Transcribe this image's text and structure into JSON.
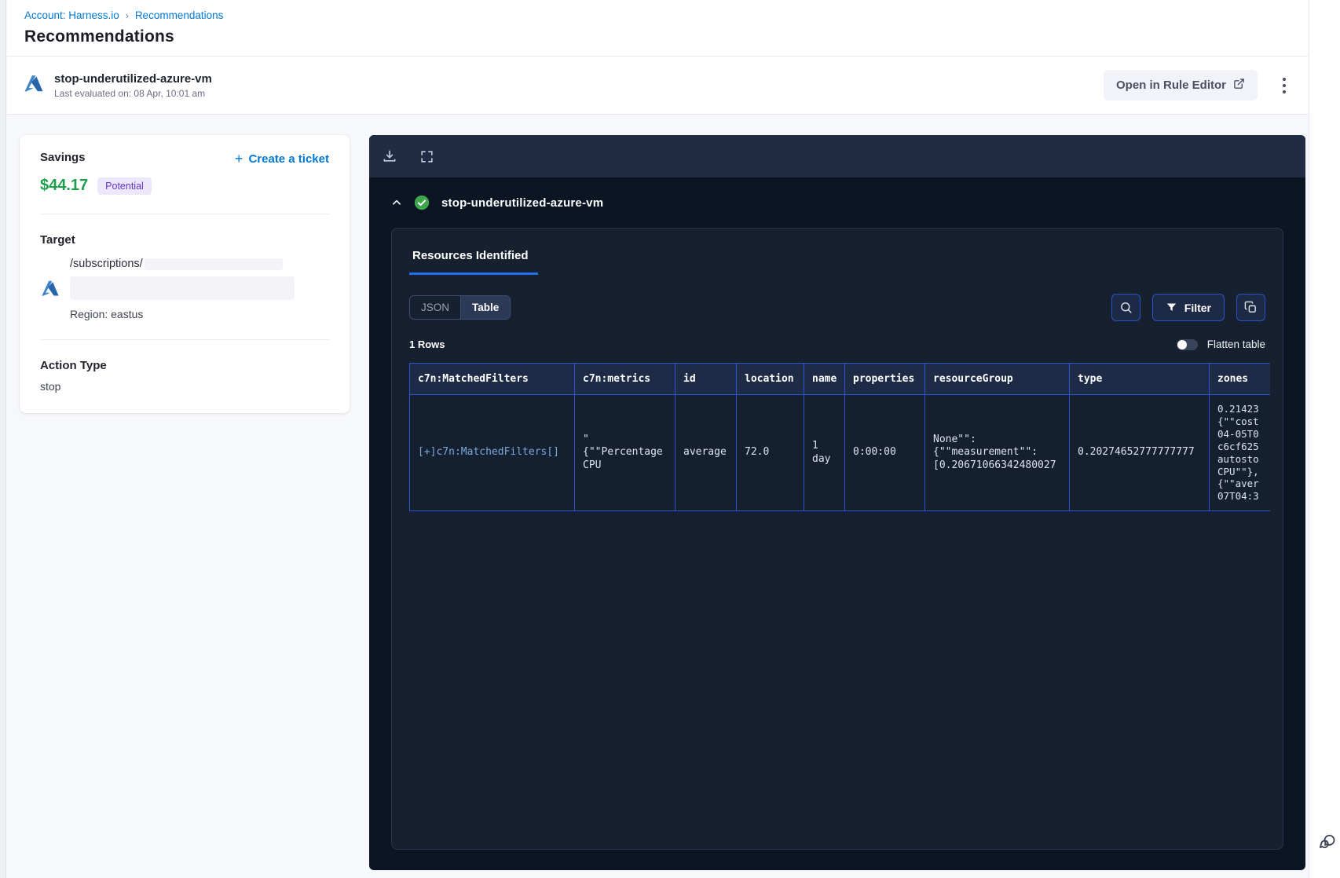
{
  "breadcrumb": {
    "account": "Account: Harness.io",
    "separator": "›",
    "current": "Recommendations"
  },
  "page": {
    "title": "Recommendations"
  },
  "header": {
    "name": "stop-underutilized-azure-vm",
    "last_evaluated": "Last evaluated on: 08 Apr, 10:01 am",
    "open_rule_editor_label": "Open in Rule Editor"
  },
  "details_card": {
    "savings_label": "Savings",
    "create_ticket_plus": "+",
    "create_ticket_label": "Create a ticket",
    "savings_amount": "$44.17",
    "savings_badge": "Potential",
    "target_label": "Target",
    "target_path": "/subscriptions/",
    "region": "Region: eastus",
    "action_type_label": "Action Type",
    "action_type_value": "stop"
  },
  "panel": {
    "title": "stop-underutilized-azure-vm",
    "tab_label": "Resources Identified",
    "view_toggle": {
      "json_label": "JSON",
      "table_label": "Table",
      "active": "Table"
    },
    "filter_label": "Filter",
    "rows_count": "1 Rows",
    "flatten_label": "Flatten table",
    "table": {
      "columns": [
        "c7n:MatchedFilters",
        "c7n:metrics",
        "id",
        "location",
        "name",
        "properties",
        "resourceGroup",
        "type",
        "zones"
      ],
      "row": {
        "matched_filters": "[+]c7n:MatchedFilters[]",
        "metrics_lines": [
          "\"",
          "{\"\"Percentage",
          "CPU"
        ],
        "id": "average",
        "location": "72.0",
        "name_lines": [
          "1",
          "day"
        ],
        "properties": "0:00:00",
        "resource_group_lines": [
          "None\"\":",
          "{\"\"measurement\"\":",
          "[0.20671066342480027"
        ],
        "type": "0.20274652777777777",
        "zones_lines": [
          "0.21423",
          "{\"\"cost",
          "04-05T0",
          "c6cf625",
          "autosto",
          "CPU\"\"},",
          "{\"\"aver",
          "07T04:3"
        ]
      }
    }
  },
  "icons": {
    "azure": "azure-logo-icon",
    "download": "download-icon",
    "fullscreen": "fullscreen-icon",
    "chevron_up": "chevron-up-icon",
    "check": "check-circle-icon",
    "search": "search-icon",
    "filter": "filter-icon",
    "copy": "copy-icon",
    "kebab": "kebab-menu-icon",
    "external_link": "external-link-icon",
    "chat": "chat-bubble-icon"
  },
  "colors": {
    "link_blue": "#0278d5",
    "savings_green": "#1f9e4d",
    "badge_bg": "#ece7fb",
    "badge_text": "#6236c9",
    "panel_bg": "#0b1524",
    "toolbar_bg": "#202c44",
    "inner_card_bg": "#16202f",
    "table_border_blue": "#2e54cf",
    "tab_underline_blue": "#1f6ff0",
    "button_border_blue": "#2952cc",
    "check_green": "#3fa64b"
  }
}
